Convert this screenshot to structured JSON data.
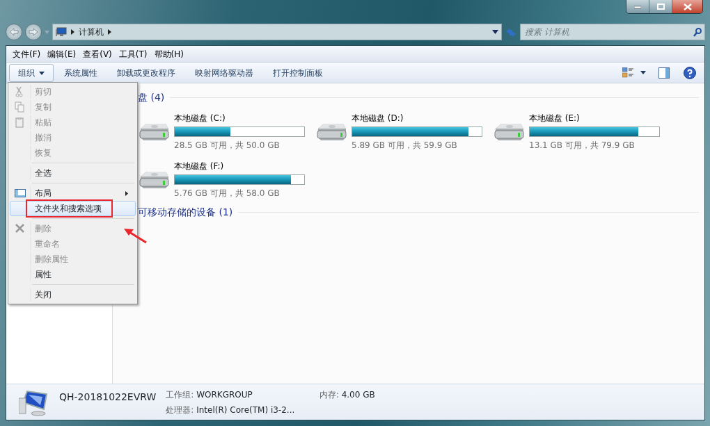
{
  "address": {
    "breadcrumb": [
      "计算机"
    ],
    "search_placeholder": "搜索 计算机"
  },
  "menubar": [
    "文件(F)",
    "编辑(E)",
    "查看(V)",
    "工具(T)",
    "帮助(H)"
  ],
  "toolbar": [
    {
      "label": "组织",
      "kind": "dropdown",
      "selected": true
    },
    {
      "label": "系统属性",
      "kind": "plain",
      "selected": false
    },
    {
      "label": "卸载或更改程序",
      "kind": "plain",
      "selected": false
    },
    {
      "label": "映射网络驱动器",
      "kind": "plain",
      "selected": false
    },
    {
      "label": "打开控制面板",
      "kind": "plain",
      "selected": false
    }
  ],
  "context_menu": [
    {
      "kind": "item",
      "label": "剪切",
      "disabled": true,
      "selected": false
    },
    {
      "kind": "item",
      "label": "复制",
      "disabled": true,
      "selected": false
    },
    {
      "kind": "item",
      "label": "粘贴",
      "disabled": true,
      "selected": false
    },
    {
      "kind": "item",
      "label": "撤消",
      "disabled": true,
      "selected": false
    },
    {
      "kind": "item",
      "label": "恢复",
      "disabled": true,
      "selected": false
    },
    {
      "kind": "separator"
    },
    {
      "kind": "item",
      "label": "全选",
      "disabled": false,
      "selected": false
    },
    {
      "kind": "separator"
    },
    {
      "kind": "submenu",
      "label": "布局",
      "disabled": false,
      "selected": false
    },
    {
      "kind": "item",
      "label": "文件夹和搜索选项",
      "disabled": false,
      "selected": true,
      "annotated": true
    },
    {
      "kind": "separator"
    },
    {
      "kind": "item",
      "label": "删除",
      "disabled": true,
      "selected": false
    },
    {
      "kind": "item",
      "label": "重命名",
      "disabled": true,
      "selected": false
    },
    {
      "kind": "item",
      "label": "删除属性",
      "disabled": true,
      "selected": false
    },
    {
      "kind": "item",
      "label": "属性",
      "disabled": false,
      "selected": false
    },
    {
      "kind": "separator"
    },
    {
      "kind": "item",
      "label": "关闭",
      "disabled": false,
      "selected": false
    }
  ],
  "sections": [
    {
      "title": "盘 (4)",
      "drives": [
        {
          "name": "本地磁盘 (C:)",
          "level": 0.43,
          "space": "28.5 GB 可用，共 50.0 GB"
        },
        {
          "name": "本地磁盘 (D:)",
          "level": 0.9,
          "space": "5.89 GB 可用，共 59.9 GB"
        },
        {
          "name": "本地磁盘 (E:)",
          "level": 0.84,
          "space": "13.1 GB 可用，共 79.9 GB"
        },
        {
          "name": "本地磁盘 (F:)",
          "level": 0.9,
          "space": "5.76 GB 可用，共 58.0 GB"
        }
      ]
    },
    {
      "title": "可移动存储的设备 (1)"
    }
  ],
  "details": {
    "computer_name": "QH-20181022EVRW",
    "fields": [
      {
        "label": "工作组:",
        "value": "WORKGROUP"
      },
      {
        "label": "内存:",
        "value": "4.00 GB"
      },
      {
        "label": "处理器:",
        "value": "Intel(R) Core(TM) i3-2..."
      }
    ]
  }
}
